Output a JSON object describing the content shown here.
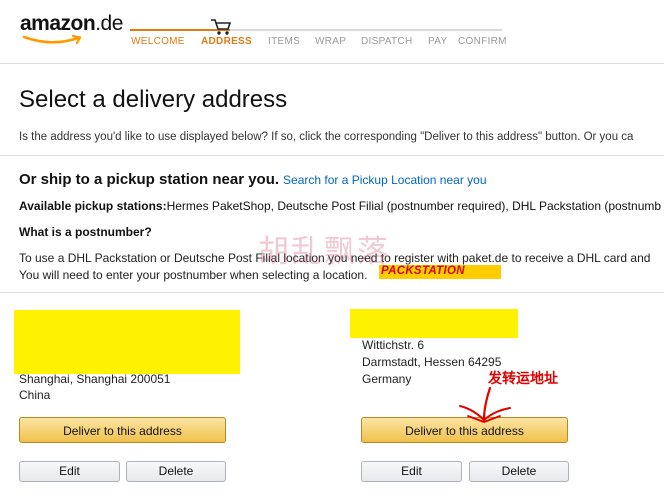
{
  "header": {
    "logo_text": "amazon",
    "logo_suffix": ".de",
    "steps": [
      "WELCOME",
      "ADDRESS",
      "ITEMS",
      "WRAP",
      "DISPATCH",
      "PAY",
      "CONFIRM"
    ],
    "active_step": "ADDRESS",
    "accent_color": "#e47911"
  },
  "main": {
    "title": "Select a delivery address",
    "intro": "Is the address you'd like to use displayed below? If so, click the corresponding \"Deliver to this address\" button. Or you ca"
  },
  "pickup": {
    "heading": "Or ship to a pickup station near you.",
    "search_link": "Search for a Pickup Location near you",
    "stations_label": "Available pickup stations:",
    "stations_text": "Hermes PaketShop, Deutsche Post Filial (postnumber required), DHL Packstation (postnumb",
    "postnumber_question": "What is a postnumber?",
    "dhl_line1": "To use a DHL Packstation or Deutsche Post Filial location you need to register with paket.de to receive a DHL card and",
    "dhl_line2": "You will need to enter your postnumber when selecting a location.",
    "packstation_logo": "PACKSTATION"
  },
  "watermark": "胡乱飘落",
  "addresses": [
    {
      "lines": [
        "Shanghai, Shanghai 200051",
        "China"
      ],
      "deliver_label": "Deliver to this address",
      "edit_label": "Edit",
      "delete_label": "Delete"
    },
    {
      "lines": [
        "Wittichstr. 6",
        "Darmstadt, Hessen 64295",
        "Germany"
      ],
      "deliver_label": "Deliver to this address",
      "edit_label": "Edit",
      "delete_label": "Delete"
    }
  ],
  "annotation": "发转运地址",
  "colors": {
    "redaction": "#fff200",
    "link": "#0066c0",
    "annotation": "#e00000"
  }
}
